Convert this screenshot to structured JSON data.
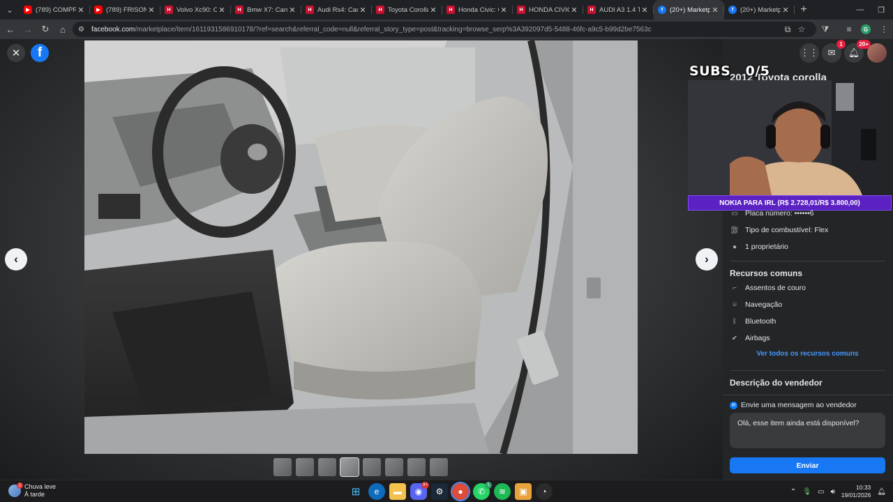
{
  "browser": {
    "tabs": [
      {
        "label": "(789) COMPRE",
        "favicon": "youtube-icon",
        "active": false
      },
      {
        "label": "(789) FRISON",
        "favicon": "youtube-icon",
        "active": false
      },
      {
        "label": "Volvo Xc90: Ca",
        "favicon": "webmotors-icon",
        "active": false
      },
      {
        "label": "Bmw X7: Carro",
        "favicon": "webmotors-icon",
        "active": false
      },
      {
        "label": "Audi Rs4: Carro",
        "favicon": "webmotors-icon",
        "active": false
      },
      {
        "label": "Toyota Corolla",
        "favicon": "webmotors-icon",
        "active": false
      },
      {
        "label": "Honda Civic: C",
        "favicon": "webmotors-icon",
        "active": false
      },
      {
        "label": "HONDA CIVIC",
        "favicon": "webmotors-icon",
        "active": false
      },
      {
        "label": "AUDI A3 1.4 TF",
        "favicon": "webmotors-icon",
        "active": false
      },
      {
        "label": "(20+) Marketpl",
        "favicon": "facebook-icon",
        "active": true
      },
      {
        "label": "(20+) Marketpl",
        "favicon": "facebook-icon",
        "active": false
      }
    ],
    "url_host": "facebook.com",
    "url_path": "/marketplace/item/1611931586910178/?ref=search&referral_code=null&referral_story_type=post&tracking=browse_serp%3A392097d5-5488-46fc-a9c5-b99d2be7563c",
    "profile_initial": "G"
  },
  "viewer": {
    "logo": "f",
    "prev_glyph": "‹",
    "next_glyph": "›",
    "close_glyph": "✕",
    "thumbnail_count": 8,
    "active_thumbnail": 3
  },
  "header": {
    "messenger_badge": "1",
    "notifications_badge": "20+"
  },
  "listing": {
    "title": "2012 Toyota corolla",
    "specs": [
      {
        "icon": "license-plate-icon",
        "label": "Placa número: ••••••6"
      },
      {
        "icon": "fuel-pump-icon",
        "label": "Tipo de combustível: Flex"
      },
      {
        "icon": "person-icon",
        "label": "1 proprietário"
      }
    ],
    "features_title": "Recursos comuns",
    "features": [
      {
        "icon": "seat-icon",
        "label": "Assentos de couro"
      },
      {
        "icon": "location-pin-icon",
        "label": "Navegação"
      },
      {
        "icon": "bluetooth-icon",
        "label": "Bluetooth"
      },
      {
        "icon": "check-circle-icon",
        "label": "Airbags"
      }
    ],
    "see_all_label": "Ver todos os recursos comuns",
    "description_title": "Descrição do vendedor"
  },
  "message": {
    "header": "Envie uma mensagem ao vendedor",
    "input_value": "Olá, esse item ainda está disponível?",
    "send_label": "Enviar"
  },
  "stream_overlay": {
    "subs_text": "SUBS   0/5",
    "donation_text": "NOKIA PARA IRL (R$ 2.728,01/R$ 3.800,00)",
    "donation_progress": 0.7179
  },
  "taskbar": {
    "weather_title": "Chuva leve",
    "weather_sub": "À tarde",
    "weather_badge": "2",
    "discord_badge": "9+",
    "whatsapp_badge": "1",
    "time": "10:33",
    "date": "19/01/2026"
  }
}
